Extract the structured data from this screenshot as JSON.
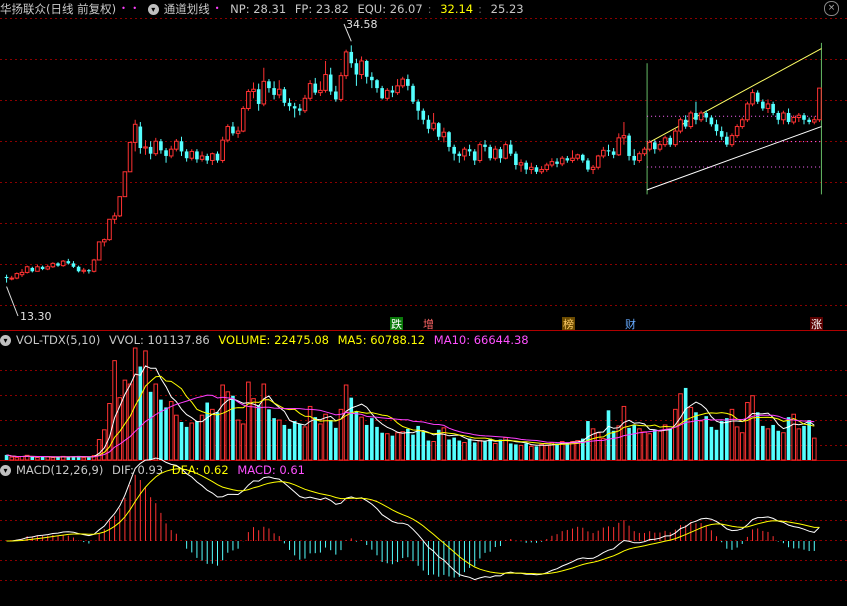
{
  "main_header": {
    "stock_name": "华扬联众(日线 前复权)",
    "indicator_name": "通道划线",
    "np": "NP: 28.31",
    "fp": "FP: 23.82",
    "equ": "EQU: 26.07",
    "v1": "32.14",
    "v2": "25.23"
  },
  "vol_header": {
    "name": "VOL-TDX(5,10)",
    "vvol": "VVOL: 101137.86",
    "volume": "VOLUME: 22475.08",
    "ma5": "MA5: 60788.12",
    "ma10": "MA10: 66644.38"
  },
  "macd_header": {
    "name": "MACD(12,26,9)",
    "dif": "DIF: 0.93",
    "dea": "DEA: 0.62",
    "macd": "MACD: 0.61"
  },
  "colors": {
    "background": "#000000",
    "up": "#ff3232",
    "down": "#54ffff",
    "grid": "#8b0000",
    "channel": "#ffff66",
    "ma5": "#ffffff",
    "ma10": "#ffff00",
    "ma_purple": "#ff40ff"
  },
  "chart_data": {
    "type": "candlestick",
    "annotations": {
      "high_label": "34.58",
      "low_label": "13.30"
    },
    "event_markers": [
      "跌",
      "增",
      "榜",
      "财",
      "涨"
    ],
    "price_range": [
      11,
      37
    ],
    "candles": [
      [
        14.1,
        14.0,
        13.6,
        14.3
      ],
      [
        14.0,
        14.0,
        13.8,
        14.2
      ],
      [
        14.0,
        14.4,
        13.9,
        14.5
      ],
      [
        14.3,
        14.5,
        14.1,
        14.8
      ],
      [
        14.5,
        15.0,
        14.4,
        15.1
      ],
      [
        14.9,
        14.6,
        14.5,
        15.0
      ],
      [
        14.6,
        15.0,
        14.6,
        15.2
      ],
      [
        15.0,
        14.8,
        14.7,
        15.1
      ],
      [
        14.8,
        15.0,
        14.7,
        15.2
      ],
      [
        15.0,
        15.3,
        14.9,
        15.4
      ],
      [
        15.3,
        15.1,
        15.0,
        15.4
      ],
      [
        15.1,
        15.5,
        15.0,
        15.6
      ],
      [
        15.5,
        15.3,
        15.2,
        15.7
      ],
      [
        15.3,
        15.0,
        14.9,
        15.5
      ],
      [
        15.0,
        14.6,
        14.5,
        15.1
      ],
      [
        14.6,
        14.7,
        14.4,
        14.9
      ],
      [
        14.7,
        14.6,
        14.4,
        14.8
      ],
      [
        14.6,
        15.6,
        14.5,
        15.7
      ],
      [
        15.6,
        17.2,
        15.6,
        17.2
      ],
      [
        17.2,
        17.4,
        16.8,
        17.5
      ],
      [
        17.4,
        19.2,
        17.3,
        19.2
      ],
      [
        19.2,
        19.5,
        18.8,
        19.8
      ],
      [
        19.5,
        21.2,
        19.4,
        21.2
      ],
      [
        21.2,
        23.4,
        21.2,
        23.4
      ],
      [
        23.4,
        26.0,
        23.4,
        26.0
      ],
      [
        26.0,
        27.6,
        25.2,
        28.0
      ],
      [
        27.4,
        25.5,
        25.0,
        27.8
      ],
      [
        25.5,
        25.6,
        24.9,
        26.2
      ],
      [
        25.6,
        25.0,
        24.5,
        26.1
      ],
      [
        25.0,
        26.1,
        24.8,
        26.4
      ],
      [
        26.1,
        25.3,
        25.0,
        26.3
      ],
      [
        25.3,
        24.8,
        24.2,
        25.5
      ],
      [
        24.8,
        25.4,
        24.6,
        25.7
      ],
      [
        25.4,
        26.1,
        25.2,
        26.3
      ],
      [
        26.1,
        25.2,
        24.8,
        26.5
      ],
      [
        25.2,
        24.6,
        24.3,
        25.4
      ],
      [
        24.6,
        25.2,
        24.4,
        25.4
      ],
      [
        25.2,
        24.5,
        24.2,
        25.4
      ],
      [
        24.5,
        24.8,
        24.3,
        25.2
      ],
      [
        24.8,
        24.4,
        24.1,
        25.0
      ],
      [
        24.4,
        25.0,
        24.0,
        25.1
      ],
      [
        25.0,
        24.4,
        24.2,
        25.2
      ],
      [
        24.4,
        26.2,
        24.2,
        26.5
      ],
      [
        26.2,
        27.4,
        26.0,
        27.6
      ],
      [
        27.4,
        26.8,
        26.6,
        27.8
      ],
      [
        26.8,
        27.0,
        26.4,
        27.4
      ],
      [
        27.0,
        29.0,
        26.9,
        29.2
      ],
      [
        29.0,
        30.5,
        28.8,
        30.7
      ],
      [
        30.5,
        30.7,
        29.9,
        31.3
      ],
      [
        30.7,
        29.4,
        28.8,
        31.2
      ],
      [
        29.4,
        31.4,
        29.2,
        32.6
      ],
      [
        31.4,
        30.8,
        30.4,
        31.6
      ],
      [
        30.8,
        30.2,
        29.8,
        31.4
      ],
      [
        30.2,
        30.7,
        29.9,
        31.5
      ],
      [
        30.7,
        29.5,
        29.2,
        30.9
      ],
      [
        29.5,
        29.2,
        28.8,
        29.9
      ],
      [
        29.2,
        29.0,
        28.2,
        29.5
      ],
      [
        29.0,
        28.8,
        28.4,
        29.4
      ],
      [
        28.8,
        29.9,
        28.6,
        30.2
      ],
      [
        29.9,
        31.2,
        29.7,
        31.5
      ],
      [
        31.2,
        30.4,
        30.2,
        31.7
      ],
      [
        30.4,
        30.6,
        30.1,
        31.4
      ],
      [
        30.6,
        32.0,
        30.4,
        33.2
      ],
      [
        32.0,
        30.5,
        30.2,
        32.6
      ],
      [
        30.5,
        29.8,
        29.6,
        31.0
      ],
      [
        29.8,
        31.9,
        29.6,
        32.2
      ],
      [
        31.9,
        34.0,
        31.6,
        34.2
      ],
      [
        34.0,
        33.0,
        32.6,
        34.58
      ],
      [
        33.0,
        32.0,
        31.0,
        33.4
      ],
      [
        32.0,
        33.2,
        31.6,
        33.6
      ],
      [
        33.2,
        31.8,
        31.2,
        33.3
      ],
      [
        31.8,
        31.5,
        30.8,
        32.2
      ],
      [
        31.5,
        30.8,
        30.4,
        31.6
      ],
      [
        30.8,
        29.9,
        29.8,
        31.0
      ],
      [
        29.9,
        30.6,
        29.7,
        30.8
      ],
      [
        30.6,
        30.4,
        30.0,
        31.0
      ],
      [
        30.4,
        31.0,
        30.2,
        31.6
      ],
      [
        31.0,
        31.6,
        30.8,
        31.8
      ],
      [
        31.6,
        31.0,
        30.6,
        32.0
      ],
      [
        31.0,
        29.6,
        29.4,
        31.2
      ],
      [
        29.6,
        28.8,
        28.0,
        29.8
      ],
      [
        28.8,
        28.0,
        27.6,
        29.0
      ],
      [
        28.0,
        27.2,
        26.8,
        28.4
      ],
      [
        27.2,
        27.7,
        27.0,
        28.6
      ],
      [
        27.7,
        26.5,
        26.2,
        27.8
      ],
      [
        26.5,
        26.9,
        26.0,
        27.3
      ],
      [
        26.9,
        25.6,
        25.2,
        27.0
      ],
      [
        25.6,
        25.0,
        24.4,
        25.8
      ],
      [
        25.0,
        24.8,
        24.2,
        25.2
      ],
      [
        24.8,
        25.4,
        24.4,
        25.6
      ],
      [
        25.4,
        25.2,
        24.8,
        25.8
      ],
      [
        25.2,
        24.4,
        24.0,
        25.4
      ],
      [
        24.4,
        25.8,
        24.2,
        26.0
      ],
      [
        25.8,
        25.6,
        25.2,
        26.2
      ],
      [
        25.6,
        24.6,
        24.4,
        25.8
      ],
      [
        24.6,
        25.4,
        24.4,
        25.7
      ],
      [
        25.4,
        24.6,
        24.2,
        25.6
      ],
      [
        24.6,
        25.8,
        24.5,
        26.0
      ],
      [
        25.8,
        25.0,
        24.8,
        26.2
      ],
      [
        25.0,
        24.0,
        23.6,
        25.2
      ],
      [
        24.0,
        24.2,
        23.4,
        24.5
      ],
      [
        24.2,
        23.6,
        23.2,
        24.4
      ],
      [
        23.6,
        23.8,
        23.2,
        24.2
      ],
      [
        23.8,
        23.4,
        23.2,
        24.0
      ],
      [
        23.4,
        23.6,
        23.2,
        23.9
      ],
      [
        23.6,
        24.0,
        23.4,
        24.2
      ],
      [
        24.0,
        24.3,
        23.8,
        24.6
      ],
      [
        24.3,
        24.1,
        23.8,
        24.6
      ],
      [
        24.1,
        24.6,
        23.9,
        24.8
      ],
      [
        24.6,
        24.4,
        24.2,
        24.8
      ],
      [
        24.4,
        24.6,
        24.2,
        25.3
      ],
      [
        24.6,
        24.9,
        24.4,
        25.0
      ],
      [
        24.9,
        24.4,
        24.2,
        25.0
      ],
      [
        24.4,
        23.6,
        23.4,
        24.6
      ],
      [
        23.6,
        23.8,
        23.2,
        24.0
      ],
      [
        23.8,
        24.8,
        23.6,
        24.9
      ],
      [
        24.8,
        25.3,
        24.6,
        25.6
      ],
      [
        25.3,
        25.2,
        24.8,
        25.8
      ],
      [
        25.2,
        24.9,
        24.6,
        25.5
      ],
      [
        24.9,
        26.4,
        24.8,
        26.8
      ],
      [
        26.4,
        26.6,
        25.8,
        27.8
      ],
      [
        26.6,
        24.8,
        24.4,
        26.8
      ],
      [
        24.8,
        24.4,
        24.0,
        25.4
      ],
      [
        24.4,
        25.0,
        24.2,
        25.2
      ],
      [
        25.0,
        25.4,
        24.8,
        25.6
      ],
      [
        25.4,
        26.0,
        25.2,
        26.2
      ],
      [
        26.0,
        25.4,
        25.0,
        26.2
      ],
      [
        25.4,
        25.8,
        25.2,
        26.0
      ],
      [
        25.8,
        26.4,
        25.6,
        26.6
      ],
      [
        26.4,
        25.8,
        25.6,
        26.6
      ],
      [
        25.8,
        27.0,
        25.6,
        27.2
      ],
      [
        27.0,
        28.0,
        26.8,
        28.2
      ],
      [
        28.0,
        27.4,
        27.2,
        28.4
      ],
      [
        27.4,
        28.6,
        27.2,
        28.8
      ],
      [
        28.6,
        28.0,
        27.6,
        29.6
      ],
      [
        28.0,
        28.6,
        27.8,
        28.8
      ],
      [
        28.6,
        28.2,
        27.8,
        28.8
      ],
      [
        28.2,
        27.6,
        27.4,
        28.4
      ],
      [
        27.6,
        27.0,
        26.6,
        28.0
      ],
      [
        27.0,
        26.5,
        26.2,
        27.4
      ],
      [
        26.5,
        25.8,
        25.6,
        26.9
      ],
      [
        25.8,
        26.6,
        25.6,
        26.8
      ],
      [
        26.6,
        27.4,
        26.4,
        27.6
      ],
      [
        27.4,
        28.0,
        27.2,
        28.2
      ],
      [
        28.0,
        29.4,
        27.8,
        29.6
      ],
      [
        29.4,
        30.4,
        29.2,
        30.7
      ],
      [
        30.4,
        29.6,
        29.4,
        30.6
      ],
      [
        29.6,
        29.0,
        28.8,
        29.8
      ],
      [
        29.0,
        29.4,
        28.6,
        29.8
      ],
      [
        29.4,
        28.6,
        28.4,
        29.6
      ],
      [
        28.6,
        28.0,
        27.6,
        28.8
      ],
      [
        28.0,
        28.6,
        27.6,
        28.8
      ],
      [
        28.6,
        27.8,
        27.6,
        29.0
      ],
      [
        27.8,
        28.2,
        27.6,
        28.4
      ],
      [
        28.2,
        28.4,
        27.8,
        28.6
      ],
      [
        28.4,
        28.0,
        27.6,
        28.6
      ],
      [
        28.0,
        27.8,
        27.6,
        28.2
      ],
      [
        27.8,
        28.0,
        27.6,
        28.3
      ],
      [
        28.0,
        30.8,
        27.8,
        30.8
      ]
    ],
    "volume_range": [
      0,
      115000
    ],
    "volumes": [
      5200,
      3000,
      2500,
      3600,
      4800,
      3100,
      2600,
      3800,
      3200,
      2400,
      2900,
      3700,
      3400,
      3800,
      4200,
      2200,
      2600,
      4600,
      21000,
      31000,
      58000,
      102000,
      64000,
      82000,
      78000,
      115000,
      96000,
      112000,
      70000,
      78000,
      62000,
      54000,
      60000,
      46000,
      39000,
      34000,
      38000,
      40000,
      46000,
      59000,
      52000,
      49000,
      77000,
      70000,
      66000,
      41000,
      37000,
      80000,
      63000,
      56000,
      78000,
      52000,
      43000,
      41000,
      36000,
      32000,
      40000,
      37000,
      34000,
      55000,
      44000,
      37000,
      47000,
      41000,
      33000,
      52000,
      77000,
      64000,
      50000,
      44000,
      36000,
      43000,
      34000,
      28000,
      27000,
      25000,
      28000,
      29000,
      32000,
      26000,
      35000,
      29000,
      20000,
      19000,
      31000,
      33000,
      21000,
      23000,
      20000,
      18000,
      22000,
      18000,
      20000,
      19000,
      22000,
      17000,
      21000,
      23000,
      17000,
      16000,
      15000,
      17000,
      14000,
      14000,
      16000,
      15000,
      18000,
      17000,
      19000,
      18000,
      19000,
      20000,
      22000,
      40000,
      32000,
      28000,
      22000,
      51000,
      30000,
      35000,
      55000,
      33000,
      36000,
      32000,
      29000,
      27000,
      31000,
      30000,
      36000,
      32000,
      52000,
      68000,
      74000,
      54000,
      49000,
      40000,
      45000,
      34000,
      31000,
      40000,
      43000,
      52000,
      34000,
      28000,
      59000,
      66000,
      49000,
      35000,
      32000,
      36000,
      30000,
      28000,
      44000,
      47000,
      32000,
      35000,
      41000,
      22475
    ],
    "macd_range": [
      -2.3,
      2.3
    ]
  }
}
